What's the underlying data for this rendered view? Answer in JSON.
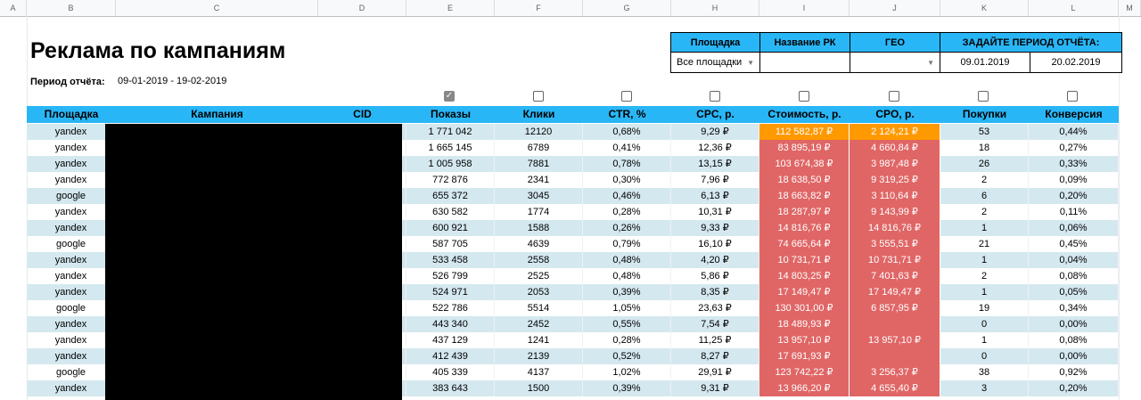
{
  "spreadsheet": {
    "column_letters": [
      "A",
      "B",
      "C",
      "D",
      "E",
      "F",
      "G",
      "H",
      "I",
      "J",
      "K",
      "L",
      "M"
    ]
  },
  "report": {
    "title": "Реклама по кампаниям",
    "period_label": "Период отчёта:",
    "period_value": "09-01-2019 - 19-02-2019"
  },
  "filters": {
    "platform_header": "Площадка",
    "campaign_name_header": "Название РК",
    "geo_header": "ГЕО",
    "period_header": "ЗАДАЙТЕ ПЕРИОД ОТЧЁТА:",
    "platform_value": "Все площадки",
    "campaign_name_value": "",
    "geo_value": "",
    "date_from": "09.01.2019",
    "date_to": "20.02.2019"
  },
  "checkboxes": [
    true,
    false,
    false,
    false,
    false,
    false,
    false
  ],
  "table": {
    "headers": [
      "Площадка",
      "Кампания",
      "CID",
      "Показы",
      "Клики",
      "CTR, %",
      "CPC, р.",
      "Стоимость, р.",
      "CPO, р.",
      "Покупки",
      "Конверсия"
    ],
    "rows": [
      {
        "platform": "yandex",
        "campaign": "",
        "cid": "",
        "impressions": "1 771 042",
        "clicks": "12120",
        "ctr": "0,68%",
        "cpc": "9,29 ₽",
        "cost": "112 582,87 ₽",
        "cpo": "2 124,21 ₽",
        "purchases": "53",
        "conversion": "0,44%",
        "highlight": "orange"
      },
      {
        "platform": "yandex",
        "campaign": "",
        "cid": "",
        "impressions": "1 665 145",
        "clicks": "6789",
        "ctr": "0,41%",
        "cpc": "12,36 ₽",
        "cost": "83 895,19 ₽",
        "cpo": "4 660,84 ₽",
        "purchases": "18",
        "conversion": "0,27%",
        "highlight": "red"
      },
      {
        "platform": "yandex",
        "campaign": "",
        "cid": "",
        "impressions": "1 005 958",
        "clicks": "7881",
        "ctr": "0,78%",
        "cpc": "13,15 ₽",
        "cost": "103 674,38 ₽",
        "cpo": "3 987,48 ₽",
        "purchases": "26",
        "conversion": "0,33%",
        "highlight": "red"
      },
      {
        "platform": "yandex",
        "campaign": "",
        "cid": "",
        "impressions": "772 876",
        "clicks": "2341",
        "ctr": "0,30%",
        "cpc": "7,96 ₽",
        "cost": "18 638,50 ₽",
        "cpo": "9 319,25 ₽",
        "purchases": "2",
        "conversion": "0,09%",
        "highlight": "red"
      },
      {
        "platform": "google",
        "campaign": "",
        "cid": "",
        "impressions": "655 372",
        "clicks": "3045",
        "ctr": "0,46%",
        "cpc": "6,13 ₽",
        "cost": "18 663,82 ₽",
        "cpo": "3 110,64 ₽",
        "purchases": "6",
        "conversion": "0,20%",
        "highlight": "red"
      },
      {
        "platform": "yandex",
        "campaign": "",
        "cid": "",
        "impressions": "630 582",
        "clicks": "1774",
        "ctr": "0,28%",
        "cpc": "10,31 ₽",
        "cost": "18 287,97 ₽",
        "cpo": "9 143,99 ₽",
        "purchases": "2",
        "conversion": "0,11%",
        "highlight": "red"
      },
      {
        "platform": "yandex",
        "campaign": "",
        "cid": "",
        "impressions": "600 921",
        "clicks": "1588",
        "ctr": "0,26%",
        "cpc": "9,33 ₽",
        "cost": "14 816,76 ₽",
        "cpo": "14 816,76 ₽",
        "purchases": "1",
        "conversion": "0,06%",
        "highlight": "red"
      },
      {
        "platform": "google",
        "campaign": "",
        "cid": "",
        "impressions": "587 705",
        "clicks": "4639",
        "ctr": "0,79%",
        "cpc": "16,10 ₽",
        "cost": "74 665,64 ₽",
        "cpo": "3 555,51 ₽",
        "purchases": "21",
        "conversion": "0,45%",
        "highlight": "red"
      },
      {
        "platform": "yandex",
        "campaign": "",
        "cid": "",
        "impressions": "533 458",
        "clicks": "2558",
        "ctr": "0,48%",
        "cpc": "4,20 ₽",
        "cost": "10 731,71 ₽",
        "cpo": "10 731,71 ₽",
        "purchases": "1",
        "conversion": "0,04%",
        "highlight": "red"
      },
      {
        "platform": "yandex",
        "campaign": "",
        "cid": "",
        "impressions": "526 799",
        "clicks": "2525",
        "ctr": "0,48%",
        "cpc": "5,86 ₽",
        "cost": "14 803,25 ₽",
        "cpo": "7 401,63 ₽",
        "purchases": "2",
        "conversion": "0,08%",
        "highlight": "red"
      },
      {
        "platform": "yandex",
        "campaign": "",
        "cid": "",
        "impressions": "524 971",
        "clicks": "2053",
        "ctr": "0,39%",
        "cpc": "8,35 ₽",
        "cost": "17 149,47 ₽",
        "cpo": "17 149,47 ₽",
        "purchases": "1",
        "conversion": "0,05%",
        "highlight": "red"
      },
      {
        "platform": "google",
        "campaign": "",
        "cid": "",
        "impressions": "522 786",
        "clicks": "5514",
        "ctr": "1,05%",
        "cpc": "23,63 ₽",
        "cost": "130 301,00 ₽",
        "cpo": "6 857,95 ₽",
        "purchases": "19",
        "conversion": "0,34%",
        "highlight": "red"
      },
      {
        "platform": "yandex",
        "campaign": "",
        "cid": "",
        "impressions": "443 340",
        "clicks": "2452",
        "ctr": "0,55%",
        "cpc": "7,54 ₽",
        "cost": "18 489,93 ₽",
        "cpo": "",
        "purchases": "0",
        "conversion": "0,00%",
        "highlight": "red"
      },
      {
        "platform": "yandex",
        "campaign": "",
        "cid": "",
        "impressions": "437 129",
        "clicks": "1241",
        "ctr": "0,28%",
        "cpc": "11,25 ₽",
        "cost": "13 957,10 ₽",
        "cpo": "13 957,10 ₽",
        "purchases": "1",
        "conversion": "0,08%",
        "highlight": "red"
      },
      {
        "platform": "yandex",
        "campaign": "",
        "cid": "",
        "impressions": "412 439",
        "clicks": "2139",
        "ctr": "0,52%",
        "cpc": "8,27 ₽",
        "cost": "17 691,93 ₽",
        "cpo": "",
        "purchases": "0",
        "conversion": "0,00%",
        "highlight": "red"
      },
      {
        "platform": "google",
        "campaign": "",
        "cid": "",
        "impressions": "405 339",
        "clicks": "4137",
        "ctr": "1,02%",
        "cpc": "29,91 ₽",
        "cost": "123 742,22 ₽",
        "cpo": "3 256,37 ₽",
        "purchases": "38",
        "conversion": "0,92%",
        "highlight": "red"
      },
      {
        "platform": "yandex",
        "campaign": "",
        "cid": "",
        "impressions": "383 643",
        "clicks": "1500",
        "ctr": "0,39%",
        "cpc": "9,31 ₽",
        "cost": "13 966,20 ₽",
        "cpo": "4 655,40 ₽",
        "purchases": "3",
        "conversion": "0,20%",
        "highlight": "red"
      }
    ]
  },
  "colors": {
    "header_bg": "#29b6f6",
    "alt_row_bg": "#d4e8ef",
    "cost_bad": "#e06666",
    "cost_warn": "#ff9900"
  }
}
